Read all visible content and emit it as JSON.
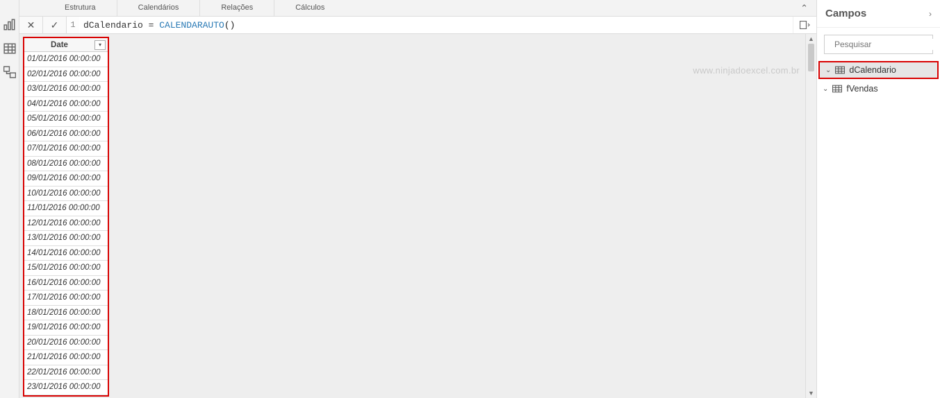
{
  "ribbon": {
    "groups": [
      "Estrutura",
      "Calendários",
      "Relações",
      "Cálculos"
    ]
  },
  "formula": {
    "line_no": "1",
    "prefix": "dCalendario = ",
    "fn": "CALENDARAUTO",
    "args": "()"
  },
  "watermark": "www.ninjadoexcel.com.br",
  "table": {
    "column": "Date",
    "rows": [
      "01/01/2016 00:00:00",
      "02/01/2016 00:00:00",
      "03/01/2016 00:00:00",
      "04/01/2016 00:00:00",
      "05/01/2016 00:00:00",
      "06/01/2016 00:00:00",
      "07/01/2016 00:00:00",
      "08/01/2016 00:00:00",
      "09/01/2016 00:00:00",
      "10/01/2016 00:00:00",
      "11/01/2016 00:00:00",
      "12/01/2016 00:00:00",
      "13/01/2016 00:00:00",
      "14/01/2016 00:00:00",
      "15/01/2016 00:00:00",
      "16/01/2016 00:00:00",
      "17/01/2016 00:00:00",
      "18/01/2016 00:00:00",
      "19/01/2016 00:00:00",
      "20/01/2016 00:00:00",
      "21/01/2016 00:00:00",
      "22/01/2016 00:00:00",
      "23/01/2016 00:00:00"
    ]
  },
  "fields": {
    "title": "Campos",
    "search_placeholder": "Pesquisar",
    "tables": [
      {
        "name": "dCalendario",
        "selected": true
      },
      {
        "name": "fVendas",
        "selected": false
      }
    ]
  }
}
